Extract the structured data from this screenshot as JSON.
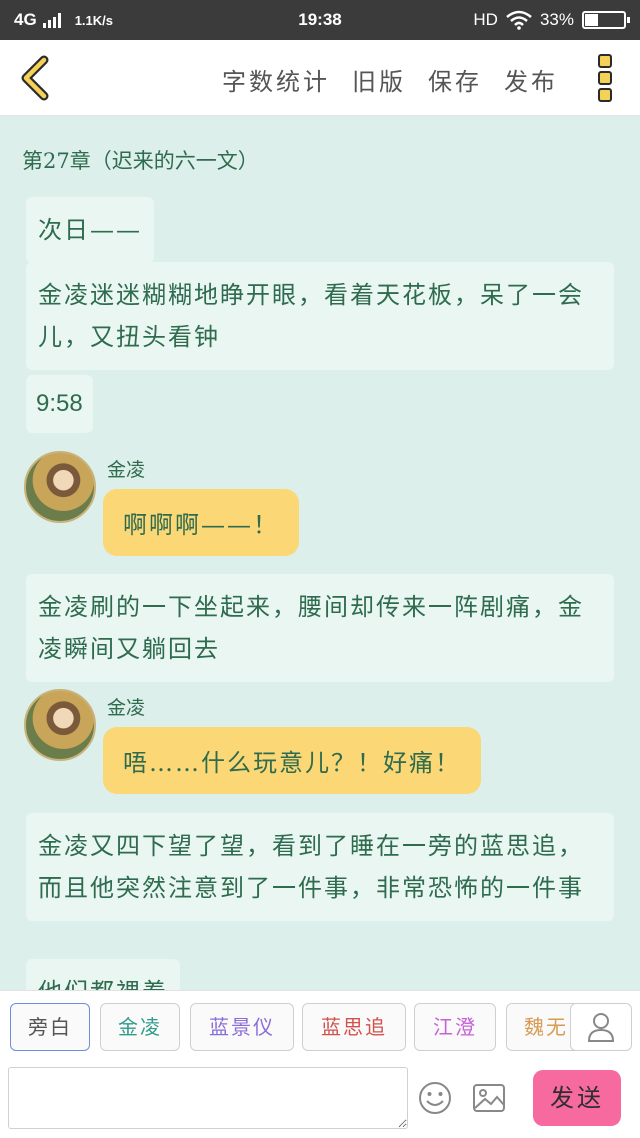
{
  "status_bar": {
    "network": "4G",
    "speed": "1.1K/s",
    "time": "19:38",
    "hd": "HD",
    "battery_text": "33%",
    "battery_level": 0.33
  },
  "toolbar": {
    "back_icon": "chevron-left-icon",
    "word_count": "字数统计",
    "old_version": "旧版",
    "save": "保存",
    "publish": "发布",
    "more_icon": "more-vertical-icon"
  },
  "story": {
    "chapter_title": "第27章（迟来的六一文）",
    "messages": [
      {
        "type": "narration",
        "text": "次日——"
      },
      {
        "type": "narration",
        "text": "金凌迷迷糊糊地睁开眼，看着天花板，呆了一会儿，又扭头看钟"
      },
      {
        "type": "narration",
        "text": "9:58"
      },
      {
        "type": "dialogue",
        "name": "金凌",
        "text": "啊啊啊——！"
      },
      {
        "type": "narration",
        "text": "金凌刷的一下坐起来，腰间却传来一阵剧痛，金凌瞬间又躺回去"
      },
      {
        "type": "dialogue",
        "name": "金凌",
        "text": "唔……什么玩意儿？！好痛！"
      },
      {
        "type": "narration",
        "text": "金凌又四下望了望，看到了睡在一旁的蓝思追，而且他突然注意到了一件事，非常恐怖的一件事"
      },
      {
        "type": "narration",
        "text": "他们都裸着"
      }
    ]
  },
  "characters": [
    {
      "label": "旁白",
      "color": "#555555"
    },
    {
      "label": "金凌",
      "color": "#2f9b8a"
    },
    {
      "label": "蓝景仪",
      "color": "#8a6ed6"
    },
    {
      "label": "蓝思追",
      "color": "#d0524a"
    },
    {
      "label": "江澄",
      "color": "#c561d6"
    },
    {
      "label": "魏无",
      "color": "#d79b52"
    }
  ],
  "input": {
    "placeholder": "",
    "send_label": "发送"
  },
  "icons": {
    "add_character": "user-icon",
    "emoji": "smiley-icon",
    "image": "image-icon"
  }
}
